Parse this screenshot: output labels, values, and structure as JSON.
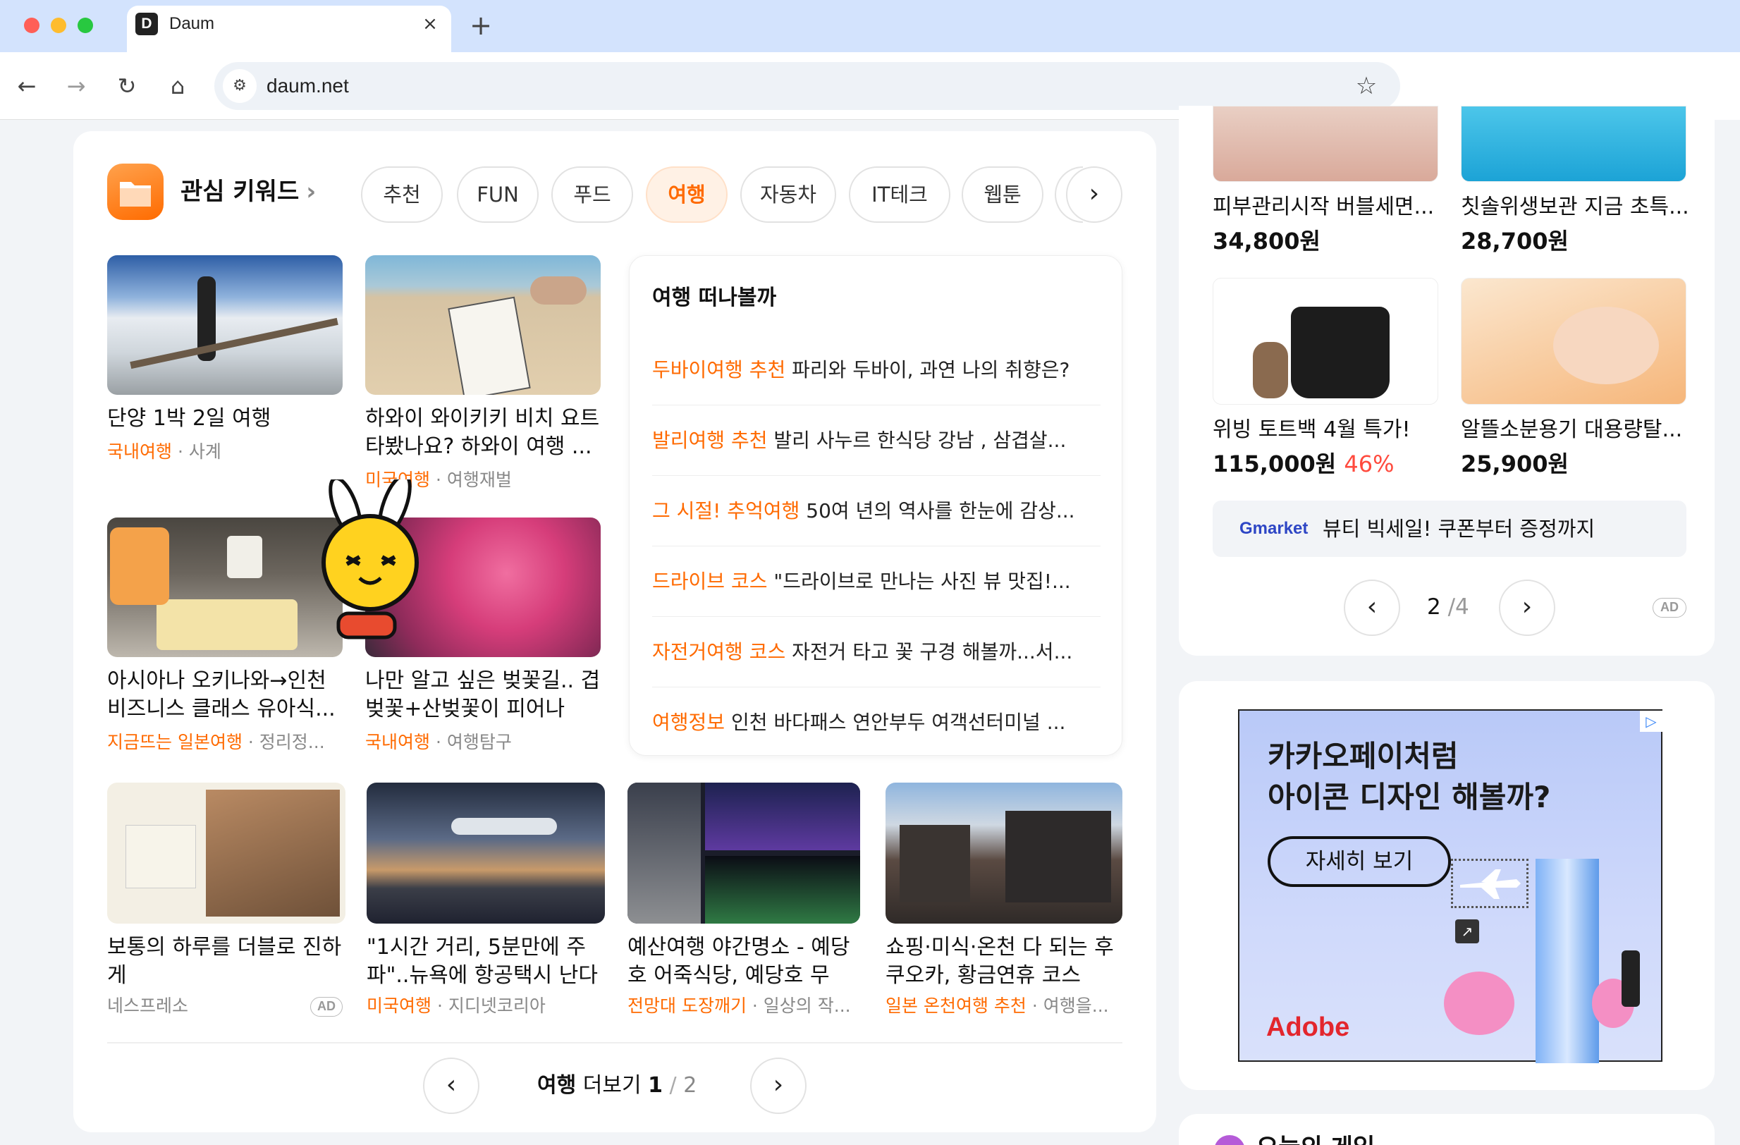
{
  "browser": {
    "tab_title": "Daum",
    "tab_favicon": "D",
    "url": "daum.net",
    "colors": {
      "tabbar": "#d3e3fd",
      "close": "#ff5f57",
      "minimize": "#febc2e",
      "zoom": "#28c840"
    }
  },
  "keywords": {
    "title": "관심 키워드",
    "chips": [
      "추천",
      "FUN",
      "푸드",
      "여행",
      "자동차",
      "IT테크",
      "웹툰"
    ],
    "active_chip": "여행"
  },
  "articles": [
    {
      "title": "단양 1박 2일 여행",
      "category": "국내여행",
      "source": "사계"
    },
    {
      "title": "하와이 와이키키 비치 요트 타봤나요? 하와이 여행 ...",
      "category": "미국여행",
      "source": "여행재벌"
    },
    {
      "title": "아시아나 오키나와→인천 비즈니스 클래스 유아식...",
      "category": "지금뜨는 일본여행",
      "source": "정리정..."
    },
    {
      "title": "나만 알고 싶은 벚꽃길.. 겹벚꽃+산벚꽃이 피어나는...",
      "category": "국내여행",
      "source": "여행탐구"
    },
    {
      "title": "보통의 하루를 더블로 진하게",
      "category": "",
      "source": "네스프레소",
      "ad": "AD"
    },
    {
      "title": "\"1시간 거리, 5분만에 주파\"..뉴욕에 항공택시 난다",
      "category": "미국여행",
      "source": "지디넷코리아"
    },
    {
      "title": "예산여행 야간명소 - 예당호 어죽식당, 예당호 무료...",
      "category": "전망대 도장깨기",
      "source": "일상의 작..."
    },
    {
      "title": "쇼핑·미식·온천 다 되는 후쿠오카, 황금연휴 코스 완...",
      "category": "일본 온천여행 추천",
      "source": "여행을..."
    }
  ],
  "travel_list": {
    "title": "여행 떠나볼까",
    "items": [
      {
        "keyword": "두바이여행 추천",
        "text": "파리와 두바이, 과연 나의 취향은?"
      },
      {
        "keyword": "발리여행 추천",
        "text": "발리 사누르 한식당 강남 , 삼겹살..."
      },
      {
        "keyword": "그 시절! 추억여행",
        "text": "50여 년의 역사를 한눈에 감상..."
      },
      {
        "keyword": "드라이브 코스",
        "text": "\"드라이브로 만나는 사진 뷰 맛집!..."
      },
      {
        "keyword": "자전거여행 코스",
        "text": "자전거 타고 꽃 구경 해볼까...서..."
      },
      {
        "keyword": "여행정보",
        "text": "인천 바다패스 연안부두 여객선터미널 ..."
      }
    ]
  },
  "pager": {
    "label": "여행",
    "more": "더보기",
    "current": "1",
    "sep": "/",
    "total": "2"
  },
  "shopping": {
    "products": [
      {
        "name": "피부관리시작 버블세면...",
        "price": "34,800원",
        "discount": ""
      },
      {
        "name": "칫솔위생보관 지금 초특...",
        "price": "28,700원",
        "discount": ""
      },
      {
        "name": "위빙 토트백 4월 특가!",
        "price": "115,000원",
        "discount": "46%"
      },
      {
        "name": "알뜰소분용기 대용량탈...",
        "price": "25,900원",
        "discount": ""
      }
    ],
    "gmarket_logo": "Gmarket",
    "promo": "뷰티 빅세일! 쿠폰부터 증정까지",
    "page_current": "2",
    "page_total": "/4",
    "ad": "AD"
  },
  "banner": {
    "line1": "카카오페이처럼",
    "line2": "아이콘 디자인 해볼까?",
    "button": "자세히 보기",
    "brand": "Adobe"
  },
  "next_card_title": "오늘의 게임"
}
